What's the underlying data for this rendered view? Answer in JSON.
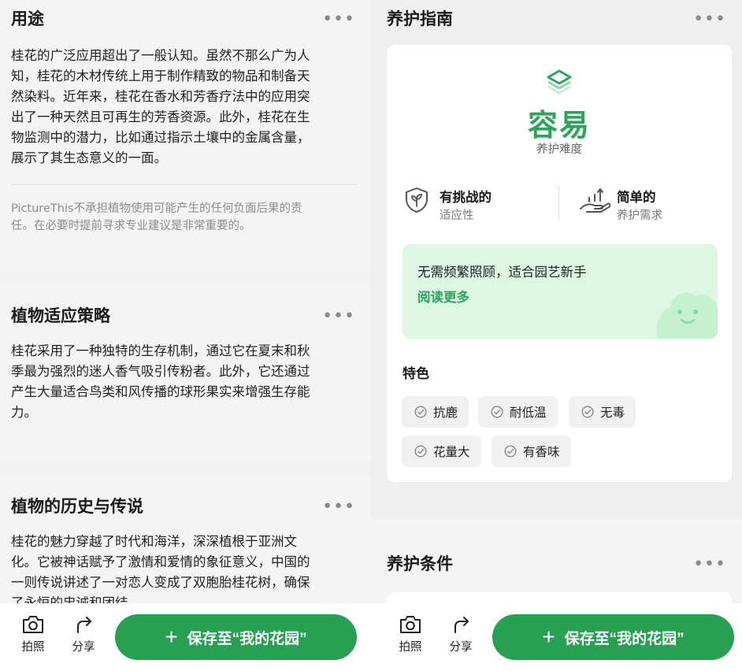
{
  "left": {
    "sections": [
      {
        "title": "用途",
        "lines": [
          "桂花的广泛应用超出了一般认知。虽然不那么广为人",
          "知，桂花的木材传统上用于制作精致的物品和制备天",
          "然染料。近年来，桂花在香水和芳香疗法中的应用突",
          "出了一种天然且可再生的芳香资源。此外，桂花在生",
          "物监测中的潜力，比如通过指示土壤中的金属含量，",
          "展示了其生态意义的一面。"
        ],
        "disclaimer_lines": [
          "PictureThis不承担植物使用可能产生的任何负面后果的责",
          "任。在必要时提前寻求专业建议是非常重要的。"
        ]
      },
      {
        "title": "植物适应策略",
        "lines": [
          "桂花采用了一种独特的生存机制，通过它在夏末和秋",
          "季最为强烈的迷人香气吸引传粉者。此外，它还通过",
          "产生大量适合鸟类和风传播的球形果实来增强生存能",
          "力。"
        ]
      },
      {
        "title": "植物的历史与传说",
        "lines": [
          "桂花的魅力穿越了时代和海洋，深深植根于亚洲文",
          "化。它被神话赋予了激情和爱情的象征意义，中国的",
          "一则传说讲述了一对恋人变成了双胞胎桂花树，确保",
          "了永恒的忠诚和团结。"
        ]
      }
    ]
  },
  "right": {
    "care_guide": {
      "title": "养护指南",
      "difficulty": "容易",
      "difficulty_label": "养护难度",
      "attributes": [
        {
          "title": "有挑战的",
          "sub": "适应性",
          "icon": "shield-leaf-icon"
        },
        {
          "title": "简单的",
          "sub": "养护需求",
          "icon": "hand-growth-icon"
        }
      ],
      "note_text": "无需频繁照顾，适合园艺新手",
      "note_link": "阅读更多",
      "features_title": "特色",
      "features": [
        "抗鹿",
        "耐低温",
        "无毒",
        "花量大",
        "有香味"
      ]
    },
    "conditions_title": "养护条件"
  },
  "bottom_bar": {
    "camera_label": "拍照",
    "share_label": "分享",
    "save_label": "保存至“我的花园”"
  },
  "colors": {
    "accent": "#27a052",
    "note_bg": "#dcf8e2"
  },
  "more_glyph": "•••"
}
